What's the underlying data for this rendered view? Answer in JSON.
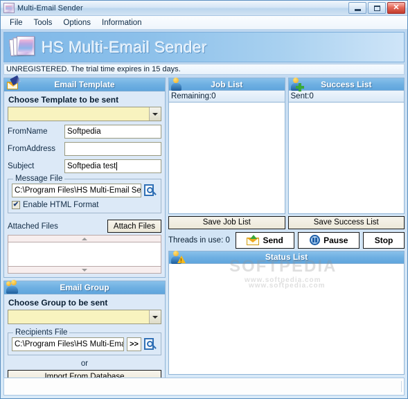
{
  "window": {
    "title": "Multi-Email Sender",
    "icon": "app-icon",
    "controls": {
      "minimize": "–",
      "maximize": "□",
      "close": "✕"
    }
  },
  "menubar": {
    "items": [
      {
        "label": "File"
      },
      {
        "label": "Tools"
      },
      {
        "label": "Options"
      },
      {
        "label": "Information"
      }
    ]
  },
  "banner": {
    "title": "HS Multi-Email Sender",
    "logo": "documents-stack-icon"
  },
  "trial": {
    "notice": "UNREGISTERED. The trial time expires in 15 days."
  },
  "email_template": {
    "header": "Email Template",
    "header_icon": "envelope-pen-icon",
    "choose_label": "Choose Template to be sent",
    "template_combo": {
      "value": "",
      "placeholder": ""
    },
    "fields": [
      {
        "label": "FromName",
        "value": "Softpedia"
      },
      {
        "label": "FromAddress",
        "value": ""
      },
      {
        "label": "Subject",
        "value": "Softpedia test",
        "focused": true
      }
    ],
    "message_file": {
      "group_title": "Message File",
      "path": "C:\\Program Files\\HS Multi-Email Sender",
      "browse_icon": "browse-file-icon"
    },
    "enable_html": {
      "label": "Enable HTML Format",
      "checked": true,
      "mark": "✔"
    },
    "attached": {
      "label": "Attached Files",
      "button": "Attach Files",
      "items": []
    }
  },
  "email_group": {
    "header": "Email Group",
    "header_icon": "users-group-icon",
    "choose_label": "Choose Group to be sent",
    "group_combo": {
      "value": "",
      "placeholder": ""
    },
    "recipients_file": {
      "group_title": "Recipients File",
      "path": "C:\\Program Files\\HS Multi-Email Se",
      "expand_button": ">>",
      "browse_icon": "browse-file-icon"
    },
    "or_text": "or",
    "import_button": "Import From Database"
  },
  "job_list": {
    "header": "Job List",
    "header_icon": "person-icon",
    "count_label": "Remaining:0",
    "items": [],
    "save_button": "Save Job List"
  },
  "success_list": {
    "header": "Success List",
    "header_icon": "person-plus-icon",
    "count_label": "Sent:0",
    "items": [],
    "save_button": "Save Success List"
  },
  "actions": {
    "threads_label": "Threads in use: 0",
    "send": {
      "label": "Send",
      "icon": "send-envelope-icon"
    },
    "pause": {
      "label": "Pause",
      "icon": "pause-circle-icon"
    },
    "stop": {
      "label": "Stop"
    }
  },
  "status_list": {
    "header": "Status List",
    "header_icon": "person-warning-icon",
    "items": []
  },
  "watermark": {
    "line1": "SOFTPEDIA",
    "line2": "www.softpedia.com",
    "line3": "www.softpedia.com"
  },
  "colors": {
    "titlebar_text": "#10314f",
    "panel_header": "#6fb0e2",
    "banner": "#8cc0ea",
    "combo_yellow": "#f8f3bf",
    "close_button": "#c23c2c"
  }
}
